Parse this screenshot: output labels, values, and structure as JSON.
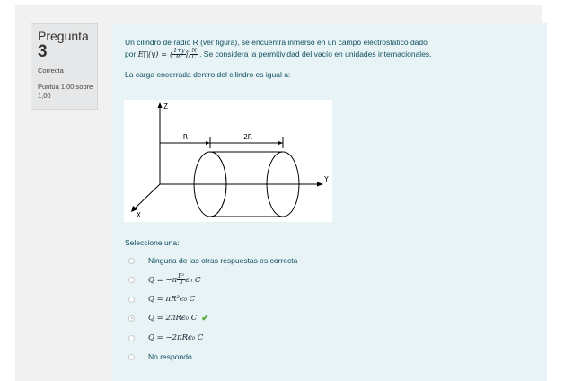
{
  "question": {
    "label": "Pregunta",
    "number": "3",
    "state": "Correcta",
    "grade": "Puntúa 1,00 sobre 1,00"
  },
  "text": {
    "line1": "Un cilindro de radio R (ver figura), se encuentra inmerso en un campo electrostático dado",
    "line2_prefix": "por",
    "line2_suffix": ". Se considera la permitividad del vacío en unidades internacionales.",
    "prompt": "La carga encerrada dentro del cilindro es igual a:"
  },
  "figure": {
    "axis_z": "Z",
    "axis_y": "Y",
    "axis_x": "X",
    "dim_r": "R",
    "dim_2r": "2R"
  },
  "answer": {
    "select_label": "Seleccione una:",
    "options": [
      {
        "text": "Ninguna de las otras respuestas es correcta",
        "selected": false
      },
      {
        "text": "Q = −π(R²/3)ϵ₀ C",
        "selected": false
      },
      {
        "text": "Q = πR²ϵ₀ C",
        "selected": false
      },
      {
        "text": "Q = 2πRϵ₀ C",
        "selected": true,
        "correct": true
      },
      {
        "text": "Q = −2πRϵ₀ C",
        "selected": false
      },
      {
        "text": "No respondo",
        "selected": false
      }
    ]
  },
  "colors": {
    "content_bg": "#e7f3f5",
    "text": "#0f4e60",
    "correct_check": "#5aa83a"
  },
  "icons": [
    "radio-button",
    "checkmark-icon"
  ]
}
